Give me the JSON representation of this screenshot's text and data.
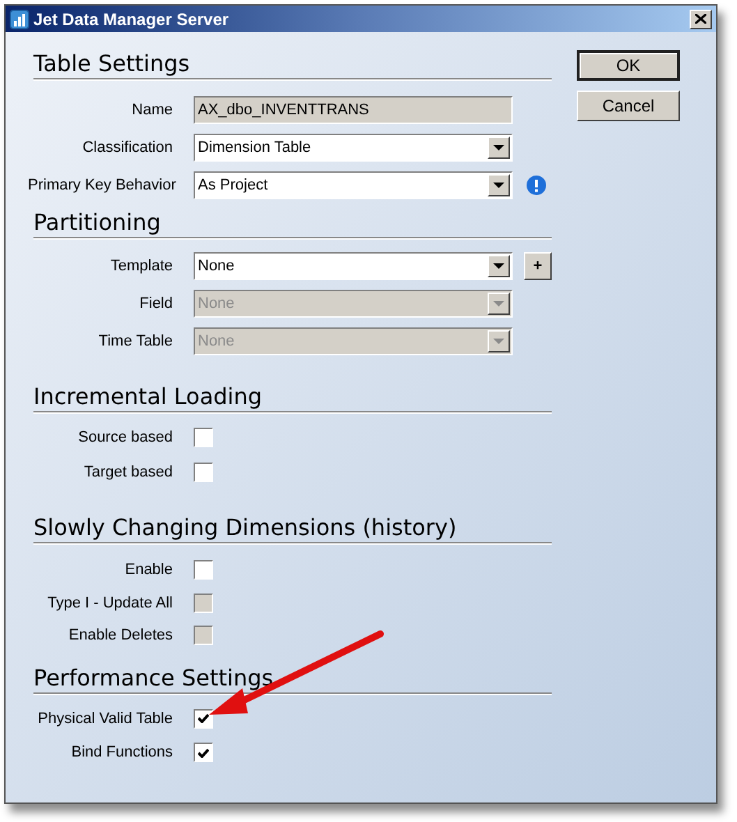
{
  "window": {
    "title": "Jet Data Manager Server"
  },
  "buttons": [
    {
      "label": "OK",
      "default": true
    },
    {
      "label": "Cancel",
      "default": false
    }
  ],
  "sections": [
    {
      "title": "Table Settings",
      "rows": [
        {
          "kind": "text",
          "label": "Name",
          "value": "AX_dbo_INVENTTRANS",
          "disabled": true
        },
        {
          "kind": "select",
          "label": "Classification",
          "value": "Dimension Table",
          "disabled": false
        },
        {
          "kind": "select",
          "label": "Primary Key Behavior",
          "value": "As Project",
          "disabled": false,
          "info": true
        }
      ]
    },
    {
      "title": "Partitioning",
      "rows": [
        {
          "kind": "select",
          "label": "Template",
          "value": "None",
          "disabled": false,
          "button": "+"
        },
        {
          "kind": "select",
          "label": "Field",
          "value": "None",
          "disabled": true
        },
        {
          "kind": "select",
          "label": "Time Table",
          "value": "None",
          "disabled": true
        }
      ]
    },
    {
      "title": "Incremental Loading",
      "rows": [
        {
          "kind": "checkbox",
          "label": "Source based",
          "checked": false,
          "disabled": false
        },
        {
          "kind": "checkbox",
          "label": "Target based",
          "checked": false,
          "disabled": false
        }
      ]
    },
    {
      "title": "Slowly Changing Dimensions (history)",
      "rows": [
        {
          "kind": "checkbox",
          "label": "Enable",
          "checked": false,
          "disabled": false
        },
        {
          "kind": "checkbox",
          "label": "Type I - Update All",
          "checked": false,
          "disabled": true
        },
        {
          "kind": "checkbox",
          "label": "Enable Deletes",
          "checked": false,
          "disabled": true
        }
      ]
    },
    {
      "title": "Performance Settings",
      "rows": [
        {
          "kind": "checkbox",
          "label": "Physical Valid Table",
          "checked": true,
          "disabled": false
        },
        {
          "kind": "checkbox",
          "label": "Bind Functions",
          "checked": true,
          "disabled": false
        }
      ]
    }
  ]
}
